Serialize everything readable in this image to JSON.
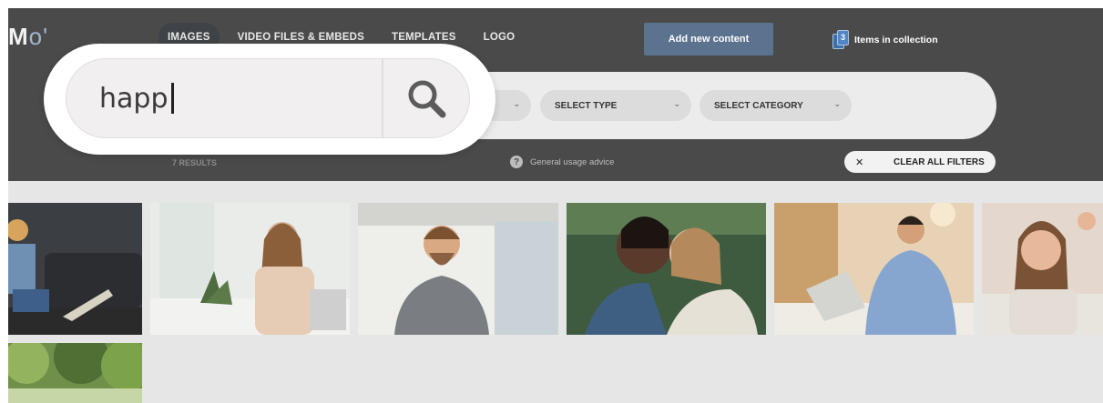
{
  "brand": {
    "logo_text": "M",
    "logo_accent": "o'"
  },
  "nav": {
    "tabs": [
      {
        "label": "IMAGES"
      },
      {
        "label": "VIDEO FILES & EMBEDS"
      },
      {
        "label": "TEMPLATES"
      },
      {
        "label": "LOGO"
      }
    ]
  },
  "header": {
    "add_button": "Add new content",
    "collection_count": "3",
    "collection_label": "Items in collection"
  },
  "search": {
    "value": "happ",
    "button_icon": "search-icon"
  },
  "filters": {
    "select_type": "SELECT TYPE",
    "select_category": "SELECT CATEGORY",
    "chevron": "⌄",
    "clear_x": "✕",
    "clear_label": "CLEAR ALL FILTERS"
  },
  "results": {
    "count_label": "7 RESULTS",
    "usage_icon": "?",
    "usage_label": "General usage advice"
  },
  "images": [
    {
      "subject": "woman-laptop-sofa"
    },
    {
      "subject": "woman-office-window"
    },
    {
      "subject": "man-grey-sweater"
    },
    {
      "subject": "two-women-laughing"
    },
    {
      "subject": "man-laptop-cafe"
    },
    {
      "subject": "woman-lying-smiling"
    },
    {
      "subject": "trees-nature"
    }
  ],
  "colors": {
    "header_bg": "#4a4a4a",
    "accent_button": "#5c7390",
    "page_bg": "#e6e6e6"
  }
}
